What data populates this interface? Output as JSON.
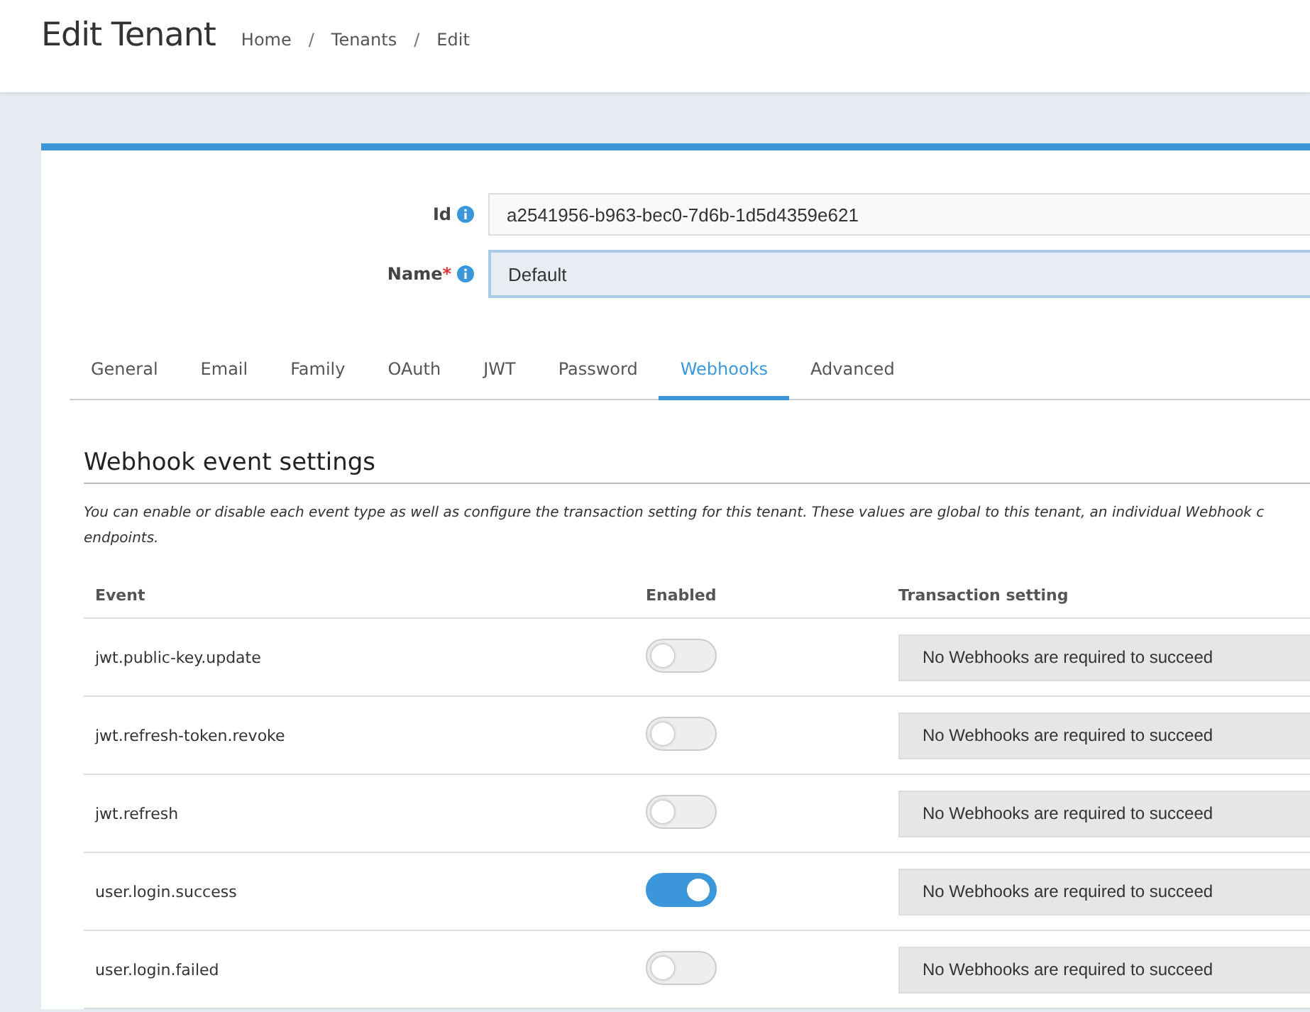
{
  "header": {
    "title": "Edit Tenant",
    "breadcrumbs": [
      {
        "kind": "link",
        "text": "Home"
      },
      {
        "kind": "separator",
        "text": "/"
      },
      {
        "kind": "link",
        "text": "Tenants"
      },
      {
        "kind": "separator",
        "text": "/"
      },
      {
        "kind": "link",
        "text": "Edit"
      }
    ]
  },
  "form": {
    "fields": [
      {
        "label": "Id",
        "value": "a2541956-b963-bec0-7d6b-1d5d4359e621",
        "focused": false
      },
      {
        "label": "Name",
        "required_mark": "*",
        "value": "Default",
        "focused": true
      }
    ]
  },
  "tabs": [
    {
      "label": "General",
      "selected": false
    },
    {
      "label": "Email",
      "selected": false
    },
    {
      "label": "Family",
      "selected": false
    },
    {
      "label": "OAuth",
      "selected": false
    },
    {
      "label": "JWT",
      "selected": false
    },
    {
      "label": "Password",
      "selected": false
    },
    {
      "label": "Webhooks",
      "selected": true
    },
    {
      "label": "Advanced",
      "selected": false
    }
  ],
  "section": {
    "title": "Webhook event settings",
    "description_lines": [
      "You can enable or disable each event type as well as configure the transaction setting for this tenant. These values are global to this tenant, an individual Webhook c",
      "endpoints."
    ]
  },
  "table": {
    "columns": [
      "Event",
      "Enabled",
      "Transaction setting"
    ],
    "rows": [
      {
        "event": "jwt.public-key.update",
        "enabled": false,
        "transaction": "No Webhooks are required to succeed"
      },
      {
        "event": "jwt.refresh-token.revoke",
        "enabled": false,
        "transaction": "No Webhooks are required to succeed"
      },
      {
        "event": "jwt.refresh",
        "enabled": false,
        "transaction": "No Webhooks are required to succeed"
      },
      {
        "event": "user.login.success",
        "enabled": true,
        "transaction": "No Webhooks are required to succeed"
      },
      {
        "event": "user.login.failed",
        "enabled": false,
        "transaction": "No Webhooks are required to succeed"
      }
    ]
  }
}
